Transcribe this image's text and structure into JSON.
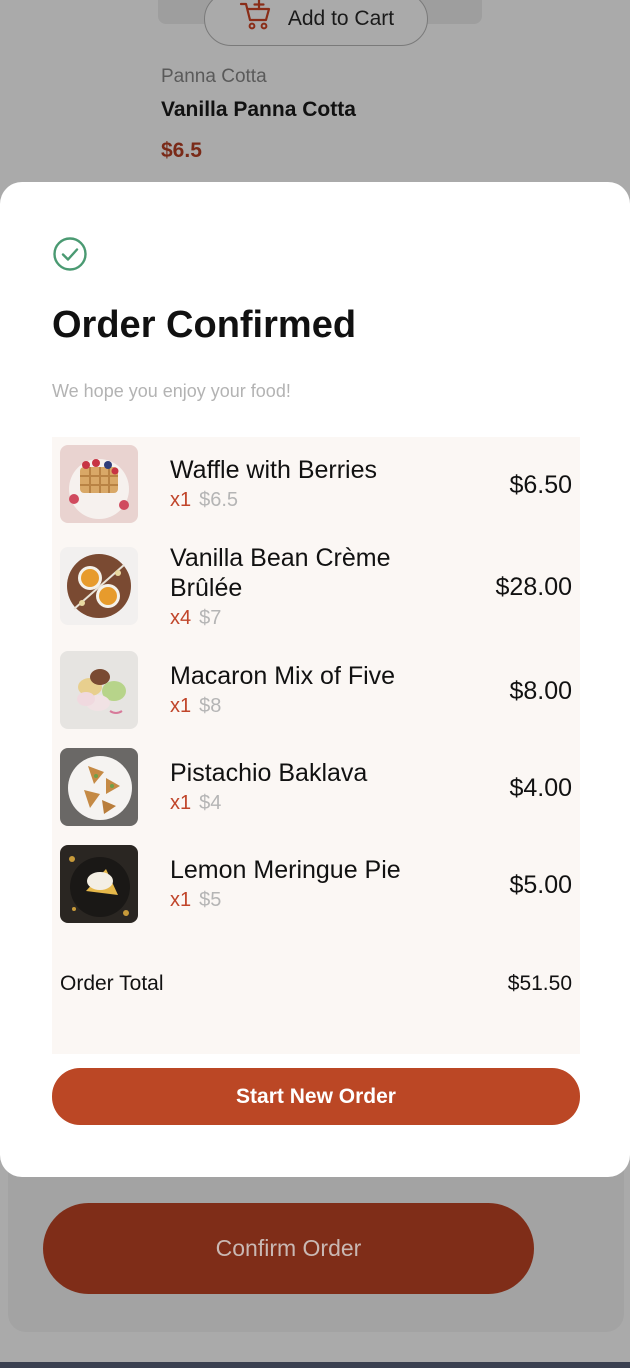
{
  "background": {
    "add_to_cart_label": "Add to Cart",
    "category": "Panna Cotta",
    "product_name": "Vanilla Panna Cotta",
    "product_price": "$6.5",
    "confirm_order_label": "Confirm Order"
  },
  "modal": {
    "title": "Order Confirmed",
    "subtitle": "We hope you enjoy your food!",
    "items": [
      {
        "name": "Waffle with Berries",
        "qty": "x1",
        "unit_price": "$6.5",
        "total": "$6.50"
      },
      {
        "name": "Vanilla Bean Crème Brûlée",
        "qty": "x4",
        "unit_price": "$7",
        "total": "$28.00"
      },
      {
        "name": "Macaron Mix of Five",
        "qty": "x1",
        "unit_price": "$8",
        "total": "$8.00"
      },
      {
        "name": "Pistachio Baklava",
        "qty": "x1",
        "unit_price": "$4",
        "total": "$4.00"
      },
      {
        "name": "Lemon Meringue Pie",
        "qty": "x1",
        "unit_price": "$5",
        "total": "$5.00"
      }
    ],
    "total_label": "Order Total",
    "total_value": "$51.50",
    "start_new_order_label": "Start New Order"
  },
  "colors": {
    "accent": "#bb4725",
    "quantity": "#c0452a",
    "success": "#4a9a72"
  },
  "icons": {
    "check": "circle-check-icon",
    "cart": "add-to-cart-icon"
  }
}
